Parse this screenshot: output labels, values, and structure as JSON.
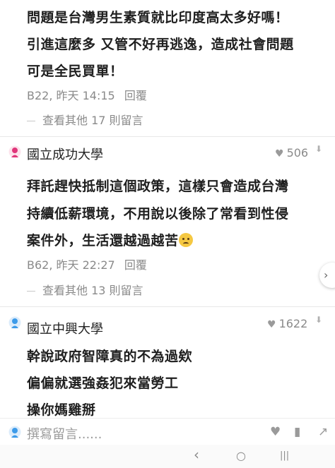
{
  "comments": [
    {
      "lines": [
        "問題是台灣男生素質就比印度高太多好嗎！",
        "引進這麼多 又管不好再逃逸，造成社會問題",
        "可是全民買單！"
      ],
      "meta": "B22, 昨天 14:15",
      "reply": "回覆",
      "more": "查看其他 17 則留言"
    },
    {
      "author": "國立成功大學",
      "likes": "506",
      "lines": [
        "拜託趕快抵制這個政策，這樣只會造成台灣",
        "持續低薪環境，不用說以後除了常看到性侵",
        "案件外，生活還越過越苦"
      ],
      "meta": "B62, 昨天 22:27",
      "reply": "回覆",
      "more": "查看其他 13 則留言",
      "avatar_color": "#e0367a"
    },
    {
      "author": "國立中興大學",
      "likes": "1622",
      "lines": [
        "幹說政府智障真的不為過欸",
        "偏偏就選強姦犯來當勞工",
        "操你媽雞掰"
      ],
      "avatar_color": "#3d9be9"
    }
  ],
  "compose": {
    "placeholder": "撰寫留言......",
    "avatar_color": "#3d9be9"
  },
  "icons": {
    "heart": "heart-icon",
    "bookmark": "bookmark-icon",
    "share": "share-icon",
    "menu": "menu-icon",
    "scroll_arrow": "chevron-right-icon"
  },
  "nav": {
    "back": "‹",
    "home": "○",
    "recent": "|||"
  }
}
